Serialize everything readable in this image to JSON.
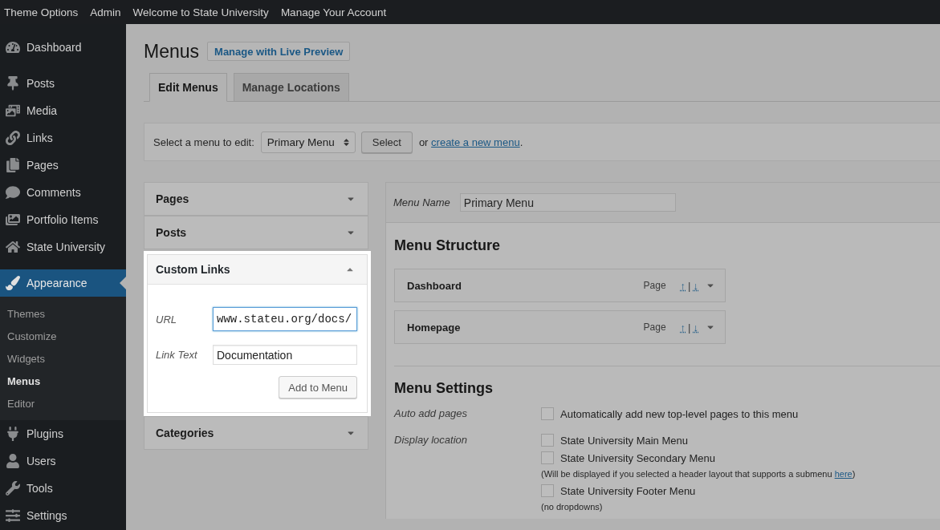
{
  "admin_bar": {
    "items": [
      "Theme Options",
      "Admin",
      "Welcome to State University",
      "Manage Your Account"
    ]
  },
  "sidebar": {
    "groups": [
      {
        "items": [
          {
            "label": "Dashboard",
            "selected": false
          }
        ]
      },
      {
        "items": [
          {
            "label": "Posts",
            "selected": false
          },
          {
            "label": "Media",
            "selected": false
          },
          {
            "label": "Links",
            "selected": false
          },
          {
            "label": "Pages",
            "selected": false
          },
          {
            "label": "Comments",
            "selected": false
          },
          {
            "label": "Portfolio Items",
            "selected": false
          },
          {
            "label": "State University",
            "selected": false
          }
        ]
      },
      {
        "items": [
          {
            "label": "Appearance",
            "selected": true,
            "children": [
              {
                "label": "Themes",
                "selected": false
              },
              {
                "label": "Customize",
                "selected": false
              },
              {
                "label": "Widgets",
                "selected": false
              },
              {
                "label": "Menus",
                "selected": true
              },
              {
                "label": "Editor",
                "selected": false
              }
            ]
          },
          {
            "label": "Plugins",
            "selected": false
          },
          {
            "label": "Users",
            "selected": false
          },
          {
            "label": "Tools",
            "selected": false
          },
          {
            "label": "Settings",
            "selected": false
          }
        ]
      }
    ]
  },
  "page": {
    "title": "Menus",
    "action": "Manage with Live Preview"
  },
  "tabs": [
    {
      "label": "Edit Menus",
      "selected": true
    },
    {
      "label": "Manage Locations",
      "selected": false
    }
  ],
  "menu_picker": {
    "label": "Select a menu to edit:",
    "value": "Primary Menu",
    "button": "Select",
    "prefix": "or",
    "link": "create a new menu",
    "suffix": "."
  },
  "add_items": {
    "sections": [
      {
        "title": "Pages",
        "expanded": false,
        "highlighted": false
      },
      {
        "title": "Posts",
        "expanded": false,
        "highlighted": false
      },
      {
        "title": "Custom Links",
        "expanded": true,
        "highlighted": true,
        "fields": [
          {
            "label": "URL",
            "kind": "url",
            "value": "www.stateu.org/docs/",
            "focused": true
          },
          {
            "label": "Link Text",
            "kind": "text",
            "value": "Documentation",
            "focused": false
          }
        ],
        "button": "Add to Menu"
      },
      {
        "title": "Categories",
        "expanded": false,
        "highlighted": false
      }
    ]
  },
  "menu_editor": {
    "name_label": "Menu Name",
    "name_value": "Primary Menu",
    "structure_title": "Menu Structure",
    "items": [
      {
        "title": "Dashboard",
        "type": "Page",
        "move_up": "↑",
        "divider": "|",
        "move_down": "↓"
      },
      {
        "title": "Homepage",
        "type": "Page",
        "move_up": "↑",
        "divider": "|",
        "move_down": "↓"
      }
    ],
    "settings_title": "Menu Settings",
    "settings": [
      {
        "label": "Auto add pages",
        "options": [
          {
            "label": "Automatically add new top-level pages to this menu",
            "checked": false
          }
        ]
      },
      {
        "label": "Display location",
        "options": [
          {
            "label": "State University Main Menu",
            "checked": false
          },
          {
            "label": "State University Secondary Menu",
            "checked": false,
            "note": {
              "text": "(Will be displayed if you selected a header layout that supports a submenu",
              "link": "here",
              "after": ")"
            }
          },
          {
            "label": "State University Footer Menu",
            "checked": false,
            "note": {
              "text": "(no dropdowns)"
            }
          }
        ]
      }
    ]
  }
}
